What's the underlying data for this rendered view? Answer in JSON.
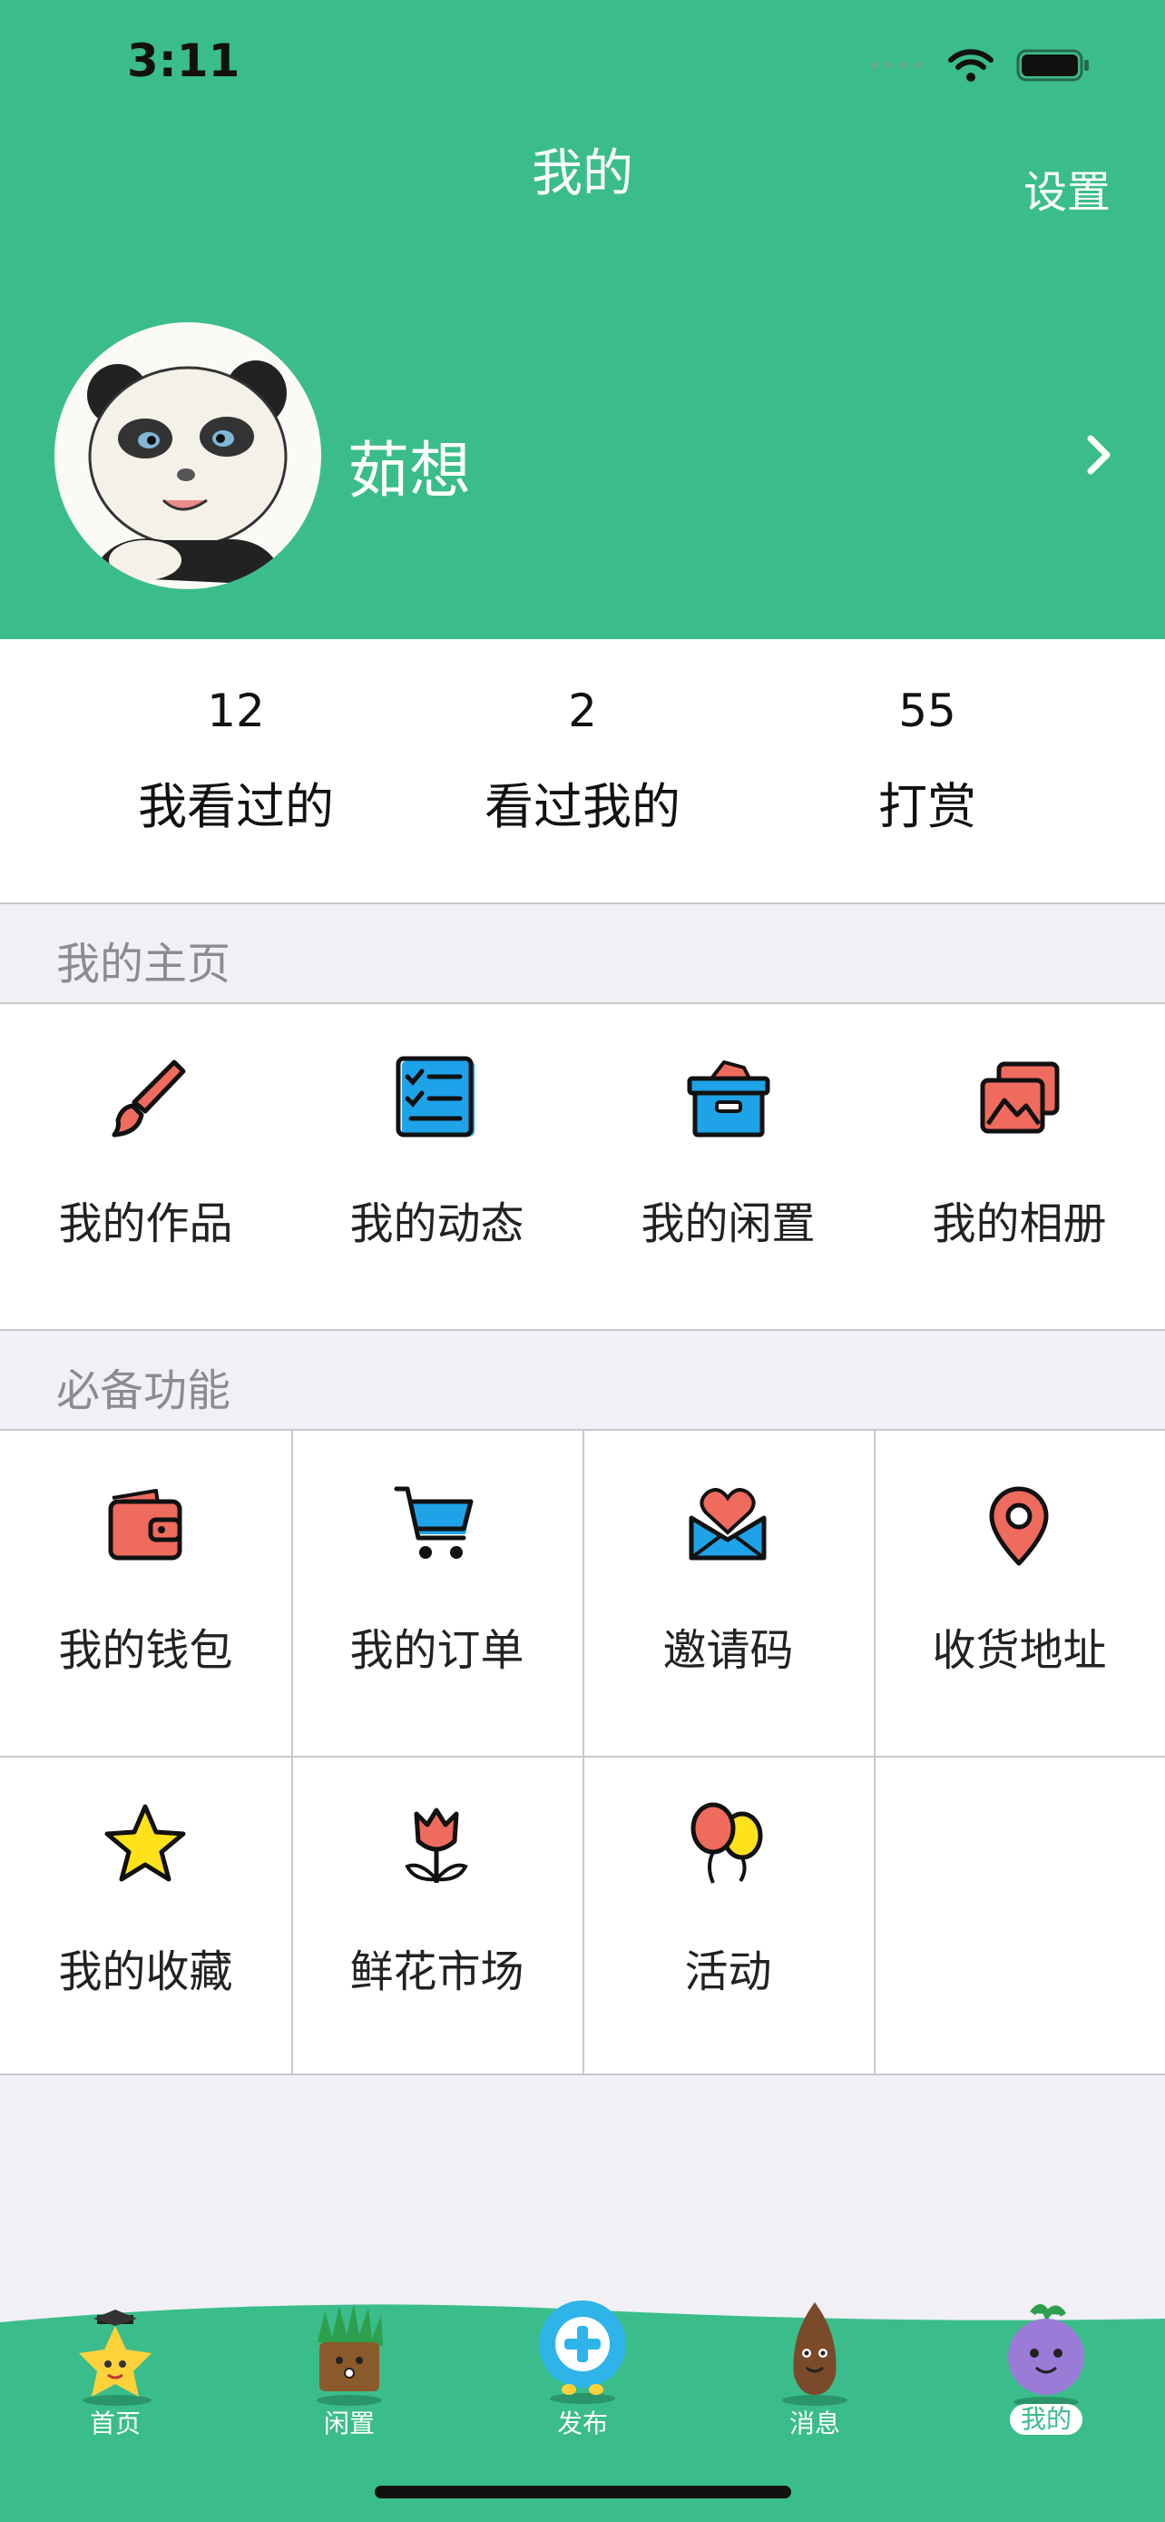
{
  "status_bar": {
    "time": "3:11"
  },
  "header": {
    "title": "我的",
    "settings_label": "设置"
  },
  "profile": {
    "username": "茹想"
  },
  "stats": [
    {
      "count": "12",
      "label": "我看过的"
    },
    {
      "count": "2",
      "label": "看过我的"
    },
    {
      "count": "55",
      "label": "打赏"
    }
  ],
  "sections": {
    "homepage_title": "我的主页",
    "features_title": "必备功能"
  },
  "homepage_items": [
    {
      "label": "我的作品",
      "icon": "paintbrush-icon"
    },
    {
      "label": "我的动态",
      "icon": "checklist-icon"
    },
    {
      "label": "我的闲置",
      "icon": "storage-box-icon"
    },
    {
      "label": "我的相册",
      "icon": "photo-album-icon"
    }
  ],
  "feature_items": [
    {
      "label": "我的钱包",
      "icon": "wallet-icon"
    },
    {
      "label": "我的订单",
      "icon": "shopping-cart-icon"
    },
    {
      "label": "邀请码",
      "icon": "heart-envelope-icon"
    },
    {
      "label": "收货地址",
      "icon": "location-pin-icon"
    },
    {
      "label": "我的收藏",
      "icon": "star-icon"
    },
    {
      "label": "鲜花市场",
      "icon": "tulip-icon"
    },
    {
      "label": "活动",
      "icon": "balloons-icon"
    }
  ],
  "tabbar": {
    "items": [
      {
        "label": "首页",
        "icon": "star-mascot-icon"
      },
      {
        "label": "闲置",
        "icon": "grass-mascot-icon"
      },
      {
        "label": "发布",
        "icon": "plus-mascot-icon"
      },
      {
        "label": "消息",
        "icon": "pinecone-mascot-icon"
      },
      {
        "label": "我的",
        "icon": "berry-mascot-icon"
      }
    ],
    "active_index": 4
  },
  "colors": {
    "brand_green": "#3bbd8b",
    "coral": "#ef6b5e",
    "blue": "#1fa3e8",
    "yellow": "#ffe21a",
    "background": "#f0f0f5"
  }
}
